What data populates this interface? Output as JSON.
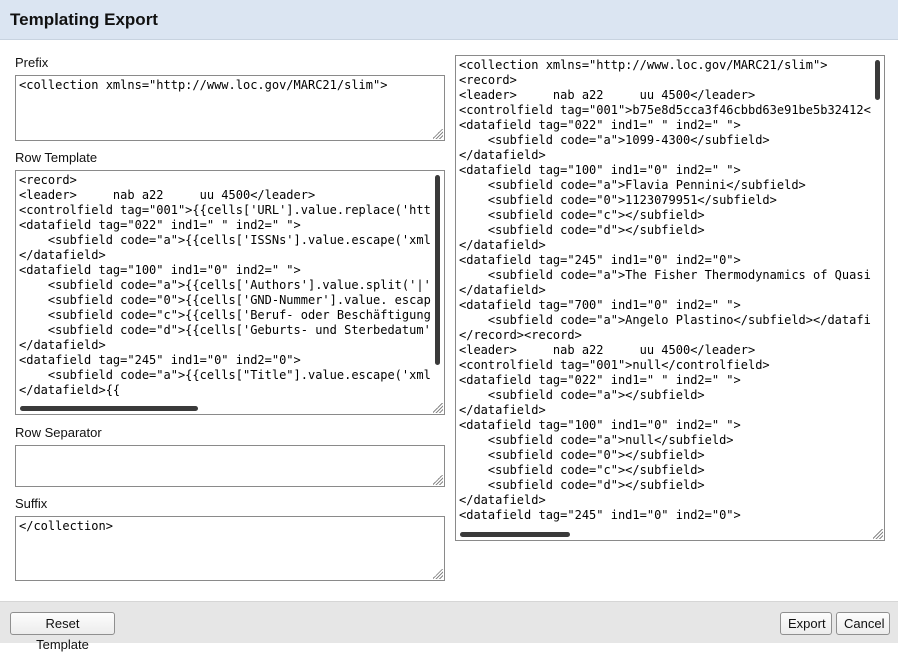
{
  "dialog": {
    "title": "Templating Export"
  },
  "prefix": {
    "label": "Prefix",
    "value": "<collection xmlns=\"http://www.loc.gov/MARC21/slim\">"
  },
  "row_template": {
    "label": "Row Template",
    "value": "<record>\n<leader>     nab a22     uu 4500</leader>\n<controlfield tag=\"001\">{{cells['URL'].value.replace('htt\n<datafield tag=\"022\" ind1=\" \" ind2=\" \">\n    <subfield code=\"a\">{{cells['ISSNs'].value.escape('xml\n</datafield>\n<datafield tag=\"100\" ind1=\"0\" ind2=\" \">\n    <subfield code=\"a\">{{cells['Authors'].value.split('|'\n    <subfield code=\"0\">{{cells['GND-Nummer'].value. escap\n    <subfield code=\"c\">{{cells['Beruf- oder Beschäftigung\n    <subfield code=\"d\">{{cells['Geburts- und Sterbedatum'\n</datafield>\n<datafield tag=\"245\" ind1=\"0\" ind2=\"0\">\n    <subfield code=\"a\">{{cells[\"Title\"].value.escape('xml\n</datafield>{{"
  },
  "row_separator": {
    "label": "Row Separator",
    "value": ""
  },
  "suffix": {
    "label": "Suffix",
    "value": "</collection>"
  },
  "preview": {
    "value": "<collection xmlns=\"http://www.loc.gov/MARC21/slim\">\n<record>\n<leader>     nab a22     uu 4500</leader>\n<controlfield tag=\"001\">b75e8d5cca3f46cbbd63e91be5b32412<\n<datafield tag=\"022\" ind1=\" \" ind2=\" \">\n    <subfield code=\"a\">1099-4300</subfield>\n</datafield>\n<datafield tag=\"100\" ind1=\"0\" ind2=\" \">\n    <subfield code=\"a\">Flavia Pennini</subfield>\n    <subfield code=\"0\">1123079951</subfield>\n    <subfield code=\"c\"></subfield>\n    <subfield code=\"d\"></subfield>\n</datafield>\n<datafield tag=\"245\" ind1=\"0\" ind2=\"0\">\n    <subfield code=\"a\">The Fisher Thermodynamics of Quasi\n</datafield>\n<datafield tag=\"700\" ind1=\"0\" ind2=\" \">\n    <subfield code=\"a\">Angelo Plastino</subfield></datafi\n</record><record>\n<leader>     nab a22     uu 4500</leader>\n<controlfield tag=\"001\">null</controlfield>\n<datafield tag=\"022\" ind1=\" \" ind2=\" \">\n    <subfield code=\"a\"></subfield>\n</datafield>\n<datafield tag=\"100\" ind1=\"0\" ind2=\" \">\n    <subfield code=\"a\">null</subfield>\n    <subfield code=\"0\"></subfield>\n    <subfield code=\"c\"></subfield>\n    <subfield code=\"d\"></subfield>\n</datafield>\n<datafield tag=\"245\" ind1=\"0\" ind2=\"0\">"
  },
  "footer": {
    "reset_label": "Reset Template",
    "export_label": "Export",
    "cancel_label": "Cancel"
  }
}
